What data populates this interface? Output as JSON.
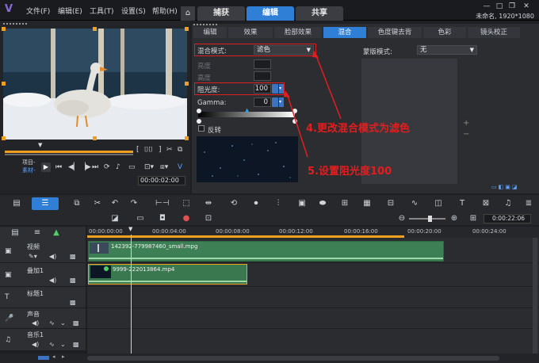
{
  "app": {
    "menus": [
      "文件(F)",
      "编辑(E)",
      "工具(T)",
      "设置(S)",
      "帮助(H)"
    ],
    "tabs": [
      "捕获",
      "编辑",
      "共享"
    ],
    "active_tab": "编辑",
    "project_info": "未命名, 1920*1080"
  },
  "preview": {
    "project_label": "项目-",
    "clip_label": "素材-",
    "timecode": "00:00:02:00"
  },
  "options_tabs": [
    "编辑",
    "效果",
    "脸部效果",
    "混合",
    "色度键去背",
    "色彩",
    "镜头校正"
  ],
  "active_options_tab": "混合",
  "blend": {
    "mode_label": "混合模式:",
    "mode_value": "滤色",
    "luminance_label": "亮度",
    "highlight_label": "高度",
    "opacity_label": "阻光度:",
    "opacity_value": "100",
    "gamma_label": "Gamma:",
    "gamma_value": "0",
    "invert_label": "反转",
    "mask_mode_label": "蒙版模式:",
    "mask_mode_value": "无"
  },
  "annotations": {
    "step4": "4.更改混合模式为滤色",
    "step5": "5.设置阻光度100"
  },
  "timeline": {
    "timecode": "0:00:22:06",
    "ruler_ticks": [
      "00:00:00:00",
      "00:00:04:00",
      "00:00:08:00",
      "00:00:12:00",
      "00:00:16:00",
      "00:00:20:00",
      "00:00:24:00"
    ],
    "tracks": [
      {
        "name": "视频"
      },
      {
        "name": "叠加1"
      },
      {
        "name": "标题1"
      },
      {
        "name": "声音"
      },
      {
        "name": "音乐1"
      }
    ],
    "video_clip": "142392-779987460_small.mpg",
    "overlay_clip": "9999-222013864.mp4"
  },
  "colors": {
    "accent": "#2f7fd6",
    "annotation": "#e41e1e",
    "clip_green": "#3e8055",
    "selection": "#f0a020"
  }
}
